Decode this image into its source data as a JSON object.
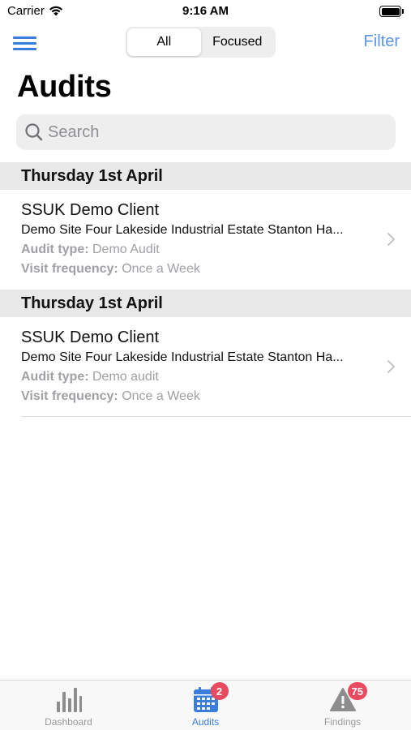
{
  "status_bar": {
    "carrier": "Carrier",
    "time": "9:16 AM"
  },
  "nav": {
    "segments": [
      "All",
      "Focused"
    ],
    "selected_segment": "All",
    "filter_label": "Filter"
  },
  "title": "Audits",
  "search": {
    "placeholder": "Search",
    "value": ""
  },
  "sections": [
    {
      "header": "Thursday 1st April",
      "item": {
        "client": "SSUK Demo Client",
        "address": "Demo Site Four Lakeside Industrial Estate Stanton Ha...",
        "audit_type_label": "Audit type:",
        "audit_type": "Demo Audit",
        "visit_frequency_label": "Visit frequency:",
        "visit_frequency": "Once a Week"
      }
    },
    {
      "header": "Thursday 1st April",
      "item": {
        "client": "SSUK Demo Client",
        "address": "Demo Site Four Lakeside Industrial Estate Stanton Ha...",
        "audit_type_label": "Audit type:",
        "audit_type": "Demo audit",
        "visit_frequency_label": "Visit frequency:",
        "visit_frequency": "Once a Week"
      }
    }
  ],
  "tab_bar": {
    "tabs": [
      {
        "label": "Dashboard",
        "icon": "bar-chart-icon",
        "badge": ""
      },
      {
        "label": "Audits",
        "icon": "calendar-icon",
        "badge": "2"
      },
      {
        "label": "Findings",
        "icon": "warning-icon",
        "badge": "75"
      }
    ],
    "active_tab": "Audits"
  },
  "colors": {
    "accent": "#3b7ddd",
    "filter": "#5b93e6",
    "badge": "#e84a5f",
    "section_header_bg": "#e8e8e8",
    "secondary_text": "#a0a0a5"
  }
}
